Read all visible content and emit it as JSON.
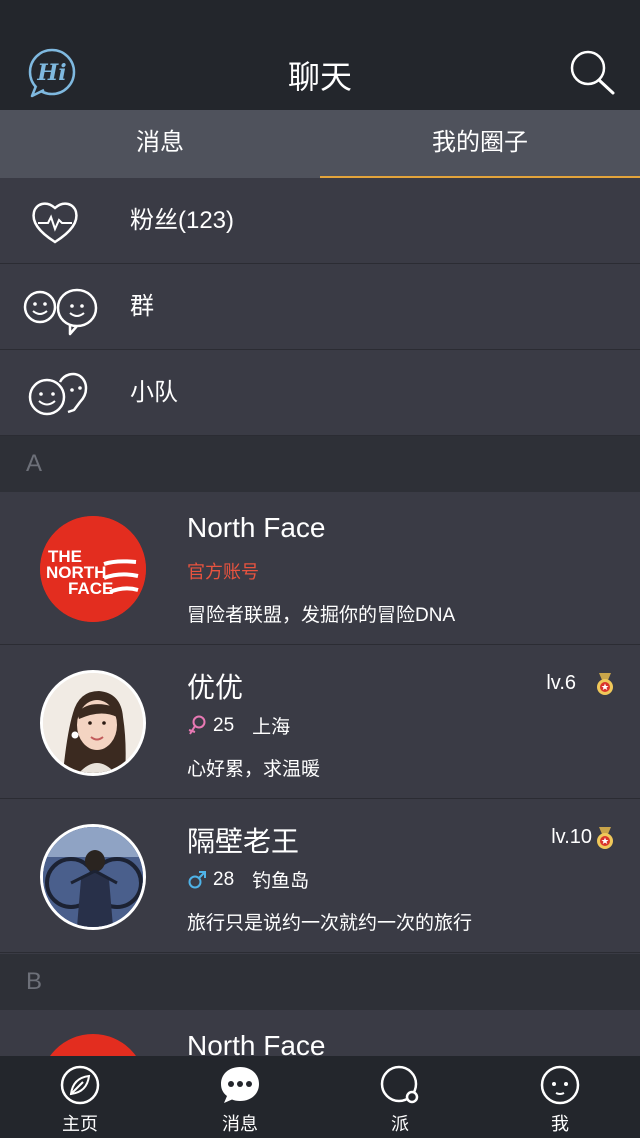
{
  "header": {
    "title": "聊天",
    "left_icon": "hi-chat-icon",
    "right_icon": "search-icon"
  },
  "tabs": [
    {
      "label": "消息",
      "active": false
    },
    {
      "label": "我的圈子",
      "active": true
    }
  ],
  "menu": [
    {
      "label": "粉丝(123)",
      "icon": "heart-pulse-icon"
    },
    {
      "label": "群",
      "icon": "group-chat-icon"
    },
    {
      "label": "小队",
      "icon": "team-chat-icon"
    }
  ],
  "sections": [
    {
      "letter": "A"
    },
    {
      "letter": "B"
    }
  ],
  "contacts": [
    {
      "name": "North Face",
      "tag": "官方账号",
      "message": "冒险者联盟，发掘你的冒险DNA",
      "logo_text": [
        "THE",
        "NORTH",
        "FACE"
      ]
    },
    {
      "name": "优优",
      "gender": "female",
      "age": "25",
      "city": "上海",
      "message": "心好累，求温暖",
      "level": "lv.6"
    },
    {
      "name": "隔壁老王",
      "gender": "male",
      "age": "28",
      "city": "钓鱼岛",
      "message": "旅行只是说约一次就约一次的旅行",
      "level": "lv.10"
    },
    {
      "name": "North Face"
    }
  ],
  "bottom_nav": [
    {
      "label": "主页",
      "icon": "leaf-icon"
    },
    {
      "label": "消息",
      "icon": "chat-bubble-icon"
    },
    {
      "label": "派",
      "icon": "circle-icon"
    },
    {
      "label": "我",
      "icon": "face-icon"
    }
  ],
  "colors": {
    "accent": "#e3a43b",
    "official": "#e8533f",
    "female": "#e879b4",
    "male": "#4fb3e8",
    "brand_red": "#e32d1f"
  }
}
